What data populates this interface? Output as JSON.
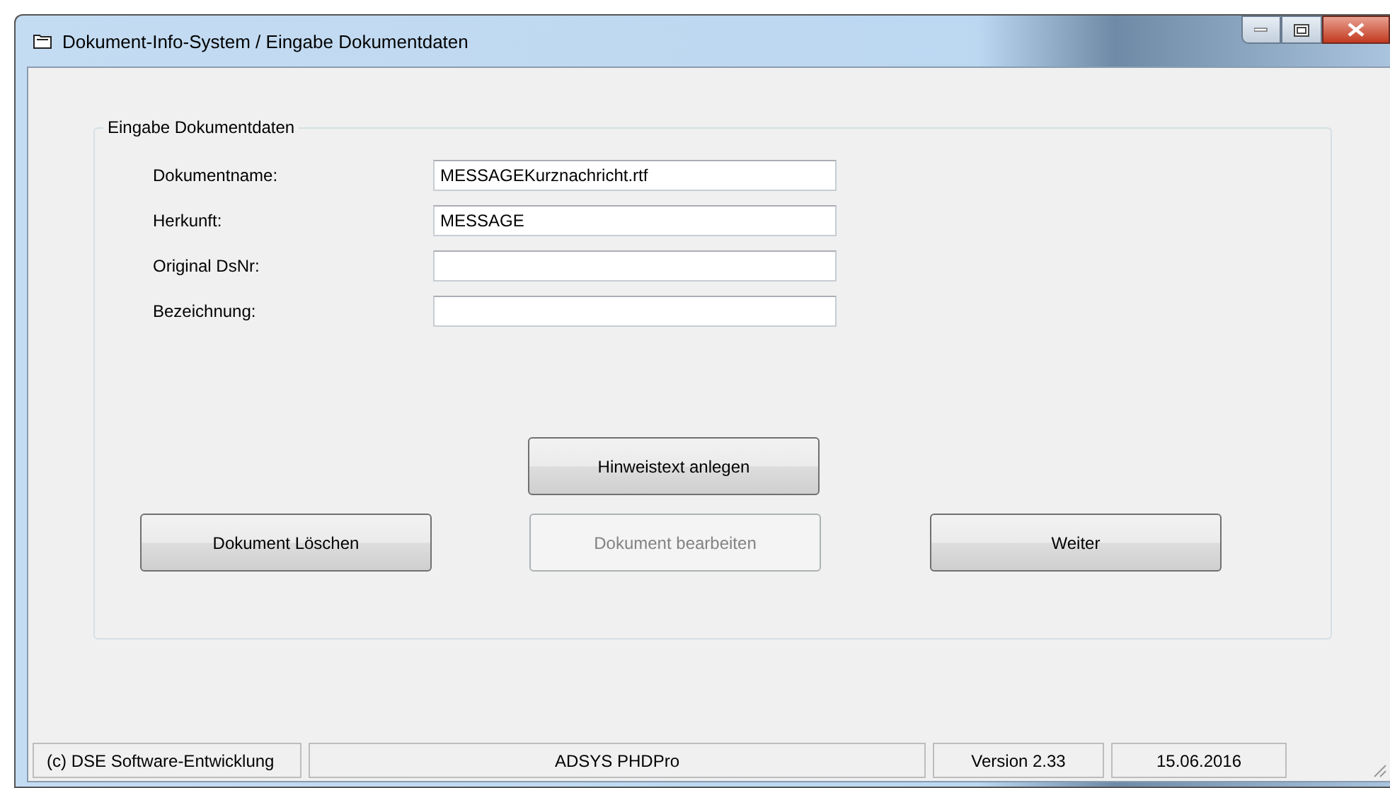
{
  "window": {
    "title": "Dokument-Info-System / Eingabe Dokumentdaten"
  },
  "group": {
    "title": "Eingabe Dokumentdaten",
    "fields": [
      {
        "label": "Dokumentname:",
        "value": "MESSAGEKurznachricht.rtf"
      },
      {
        "label": "Herkunft:",
        "value": "MESSAGE"
      },
      {
        "label": "Original DsNr:"
      },
      {
        "label": "Bezeichnung:"
      }
    ],
    "top_button": {
      "label": "Hinweistext anlegen",
      "disabled": false
    },
    "buttons": [
      {
        "label": "Dokument Löschen",
        "disabled": false
      },
      {
        "label": "Dokument bearbeiten",
        "disabled": true
      },
      {
        "label": "Weiter",
        "disabled": false
      }
    ]
  },
  "status_bar": [
    "(c) DSE Software-Entwicklung",
    "ADSYS PHDPro",
    "Version 2.33",
    "15.06.2016"
  ]
}
